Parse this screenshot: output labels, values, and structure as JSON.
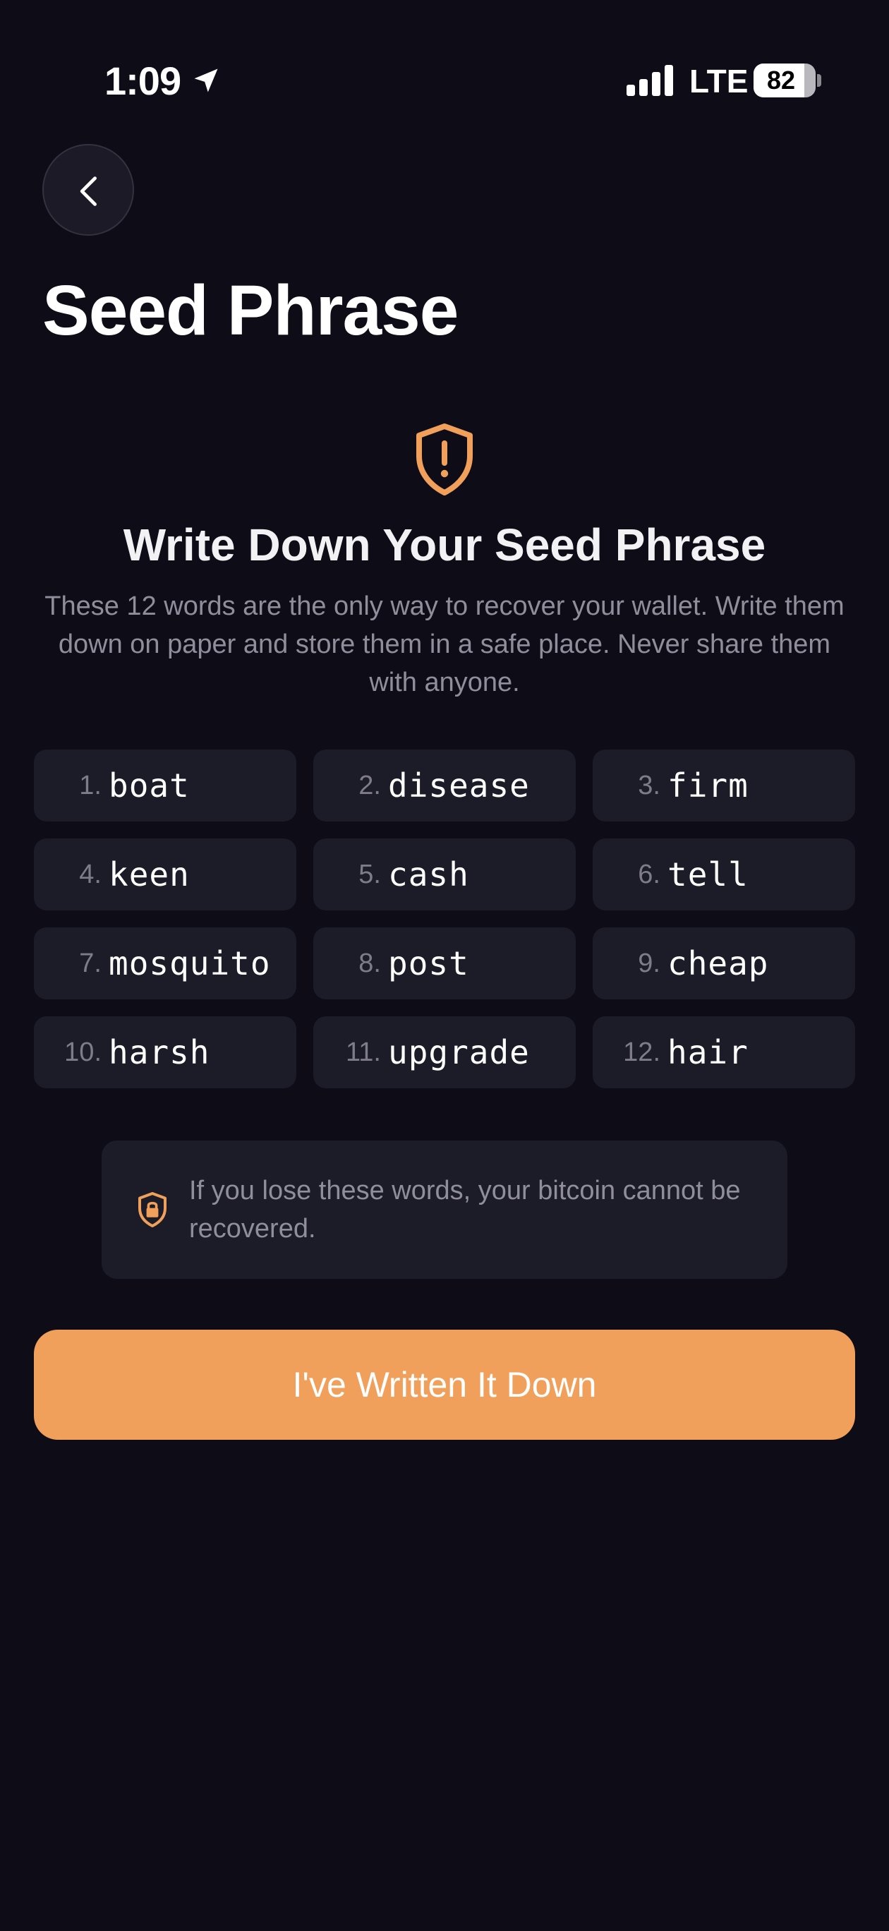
{
  "status_bar": {
    "time": "1:09",
    "network": "LTE",
    "battery_percent": 82
  },
  "header": {
    "title": "Seed Phrase"
  },
  "intro": {
    "heading": "Write Down Your Seed Phrase",
    "description": "These 12 words are the only way to recover your wallet. Write them down on paper and store them in a safe place. Never share them with anyone."
  },
  "seed_words": [
    {
      "number": "1.",
      "word": "boat"
    },
    {
      "number": "2.",
      "word": "disease"
    },
    {
      "number": "3.",
      "word": "firm"
    },
    {
      "number": "4.",
      "word": "keen"
    },
    {
      "number": "5.",
      "word": "cash"
    },
    {
      "number": "6.",
      "word": "tell"
    },
    {
      "number": "7.",
      "word": "mosquito"
    },
    {
      "number": "8.",
      "word": "post"
    },
    {
      "number": "9.",
      "word": "cheap"
    },
    {
      "number": "10.",
      "word": "harsh"
    },
    {
      "number": "11.",
      "word": "upgrade"
    },
    {
      "number": "12.",
      "word": "hair"
    }
  ],
  "warning": {
    "text": "If you lose these words, your bitcoin cannot be recovered."
  },
  "actions": {
    "confirm_label": "I've Written It Down"
  },
  "icons": {
    "back": "chevron-left-icon",
    "heading": "shield-alert-icon",
    "warning": "shield-lock-icon",
    "location": "location-arrow-icon",
    "signal": "cellular-signal-icon"
  },
  "colors": {
    "background": "#0e0d17",
    "card": "#1c1b28",
    "accent": "#f0a05a",
    "muted_text": "#8f8e9a"
  }
}
